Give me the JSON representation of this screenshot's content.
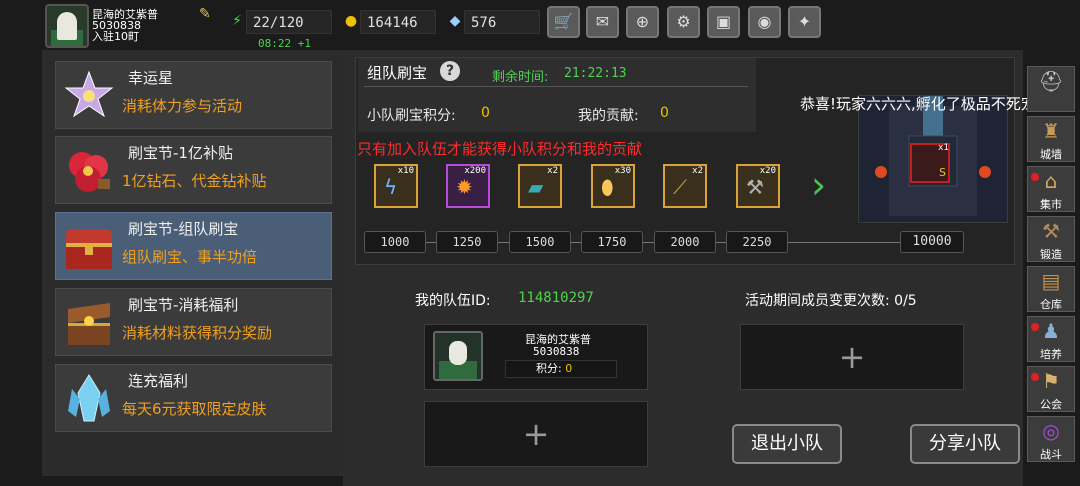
{
  "player": {
    "name": "昆海的艾紫普",
    "id": "5030838",
    "status": "入驻10町",
    "energy": "22/120",
    "energy_timer": "08:22 +1",
    "gold": "164146",
    "gems": "576"
  },
  "toolbar": {
    "icons": [
      "cart-icon",
      "mail-icon",
      "gamepad-icon",
      "gear-icon",
      "gift-icon",
      "palette-icon",
      "feather-icon"
    ]
  },
  "events": [
    {
      "title": "幸运星",
      "subtitle": "消耗体力参与活动",
      "icon": "star-gem-icon"
    },
    {
      "title": "刷宝节-1亿补贴",
      "subtitle": "1亿钻石、代金钻补贴",
      "icon": "red-flower-icon"
    },
    {
      "title": "刷宝节-组队刷宝",
      "subtitle": "组队刷宝、事半功倍",
      "icon": "treasure-chest-icon",
      "selected": true
    },
    {
      "title": "刷宝节-消耗福利",
      "subtitle": "消耗材料获得积分奖励",
      "icon": "open-chest-icon"
    },
    {
      "title": "连充福利",
      "subtitle": "每天6元获取限定皮肤",
      "icon": "ice-crystal-icon"
    }
  ],
  "team_event": {
    "title": "组队刷宝",
    "remaining_label": "剩余时间:",
    "remaining_value": "21:22:13",
    "team_score_label": "小队刷宝积分:",
    "team_score_value": "0",
    "my_contrib_label": "我的贡献:",
    "my_contrib_value": "0",
    "warning": "只有加入队伍才能获得小队积分和我的贡献",
    "rewards": [
      {
        "count": "x10",
        "icon": "lightning-icon"
      },
      {
        "count": "x200",
        "icon": "flame-orb-icon"
      },
      {
        "count": "x2",
        "icon": "spellbook-icon"
      },
      {
        "count": "x30",
        "icon": "egg-icon"
      },
      {
        "count": "x2",
        "icon": "scroll-icon"
      },
      {
        "count": "x20",
        "icon": "hammer-icon"
      }
    ],
    "milestones": [
      "1000",
      "1250",
      "1500",
      "1750",
      "2000",
      "2250",
      "10000"
    ],
    "grand_prize_count": "x1",
    "notice": "恭喜!玩家六六六,孵化了极品不死宠"
  },
  "team": {
    "id_label": "我的队伍ID:",
    "id_value": "114810297",
    "changes_label": "活动期间成员变更次数:",
    "changes_value": "0/5",
    "member": {
      "name": "昆海的艾紫普",
      "id": "5030838",
      "score_label": "积分:",
      "score_value": "0"
    },
    "leave_label": "退出小队",
    "share_label": "分享小队"
  },
  "sidebar": [
    {
      "label": "",
      "icon": "knight-helmet-icon"
    },
    {
      "label": "城墙",
      "icon": "castle-wall-icon"
    },
    {
      "label": "集市",
      "icon": "market-icon"
    },
    {
      "label": "锻造",
      "icon": "anvil-icon"
    },
    {
      "label": "仓库",
      "icon": "warehouse-icon"
    },
    {
      "label": "培养",
      "icon": "training-icon"
    },
    {
      "label": "公会",
      "icon": "guild-icon"
    },
    {
      "label": "战斗",
      "icon": "portal-icon"
    }
  ]
}
